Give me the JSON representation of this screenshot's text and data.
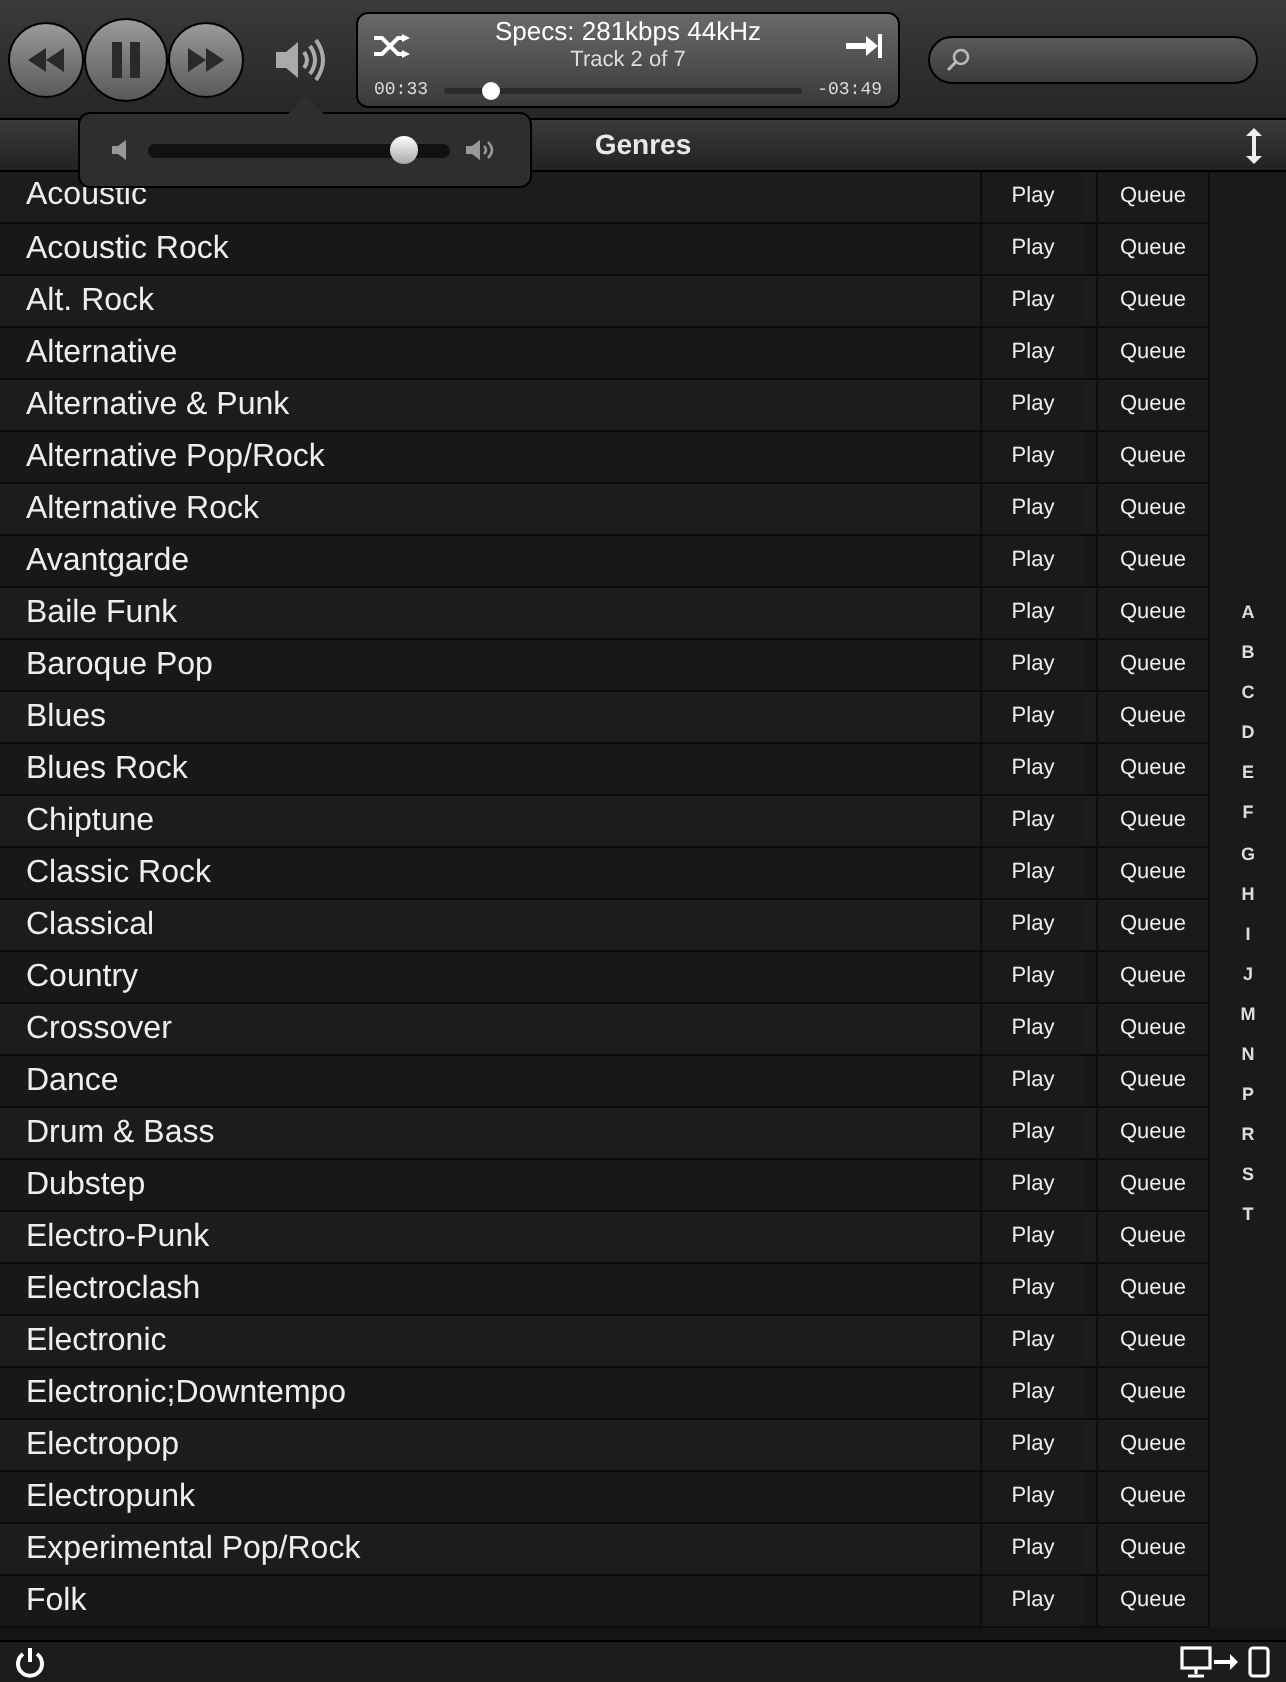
{
  "now_playing": {
    "title": "Specs: 281kbps 44kHz",
    "subtitle": "Track 2 of 7",
    "elapsed": "00:33",
    "remaining": "-03:49",
    "level": 0.13
  },
  "volume": {
    "level": 0.85
  },
  "header": {
    "title": "Genres"
  },
  "rows": [
    {
      "name": "Acoustic",
      "play": "Play",
      "queue": "Queue"
    },
    {
      "name": "Acoustic Rock",
      "play": "Play",
      "queue": "Queue"
    },
    {
      "name": "Alt. Rock",
      "play": "Play",
      "queue": "Queue"
    },
    {
      "name": "Alternative",
      "play": "Play",
      "queue": "Queue"
    },
    {
      "name": "Alternative & Punk",
      "play": "Play",
      "queue": "Queue"
    },
    {
      "name": "Alternative Pop/Rock",
      "play": "Play",
      "queue": "Queue"
    },
    {
      "name": "Alternative Rock",
      "play": "Play",
      "queue": "Queue"
    },
    {
      "name": "Avantgarde",
      "play": "Play",
      "queue": "Queue"
    },
    {
      "name": "Baile Funk",
      "play": "Play",
      "queue": "Queue"
    },
    {
      "name": "Baroque Pop",
      "play": "Play",
      "queue": "Queue"
    },
    {
      "name": "Blues",
      "play": "Play",
      "queue": "Queue"
    },
    {
      "name": "Blues Rock",
      "play": "Play",
      "queue": "Queue"
    },
    {
      "name": "Chiptune",
      "play": "Play",
      "queue": "Queue"
    },
    {
      "name": "Classic Rock",
      "play": "Play",
      "queue": "Queue"
    },
    {
      "name": "Classical",
      "play": "Play",
      "queue": "Queue"
    },
    {
      "name": "Country",
      "play": "Play",
      "queue": "Queue"
    },
    {
      "name": "Crossover",
      "play": "Play",
      "queue": "Queue"
    },
    {
      "name": "Dance",
      "play": "Play",
      "queue": "Queue"
    },
    {
      "name": "Drum & Bass",
      "play": "Play",
      "queue": "Queue"
    },
    {
      "name": "Dubstep",
      "play": "Play",
      "queue": "Queue"
    },
    {
      "name": "Electro-Punk",
      "play": "Play",
      "queue": "Queue"
    },
    {
      "name": "Electroclash",
      "play": "Play",
      "queue": "Queue"
    },
    {
      "name": "Electronic",
      "play": "Play",
      "queue": "Queue"
    },
    {
      "name": "Electronic;Downtempo",
      "play": "Play",
      "queue": "Queue"
    },
    {
      "name": "Electropop",
      "play": "Play",
      "queue": "Queue"
    },
    {
      "name": "Electropunk",
      "play": "Play",
      "queue": "Queue"
    },
    {
      "name": "Experimental Pop/Rock",
      "play": "Play",
      "queue": "Queue"
    },
    {
      "name": "Folk",
      "play": "Play",
      "queue": "Queue"
    }
  ],
  "index_letters": [
    "A",
    "B",
    "C",
    "D",
    "E",
    "F",
    "G",
    "H",
    "I",
    "J",
    "M",
    "N",
    "P",
    "R",
    "S",
    "T"
  ]
}
